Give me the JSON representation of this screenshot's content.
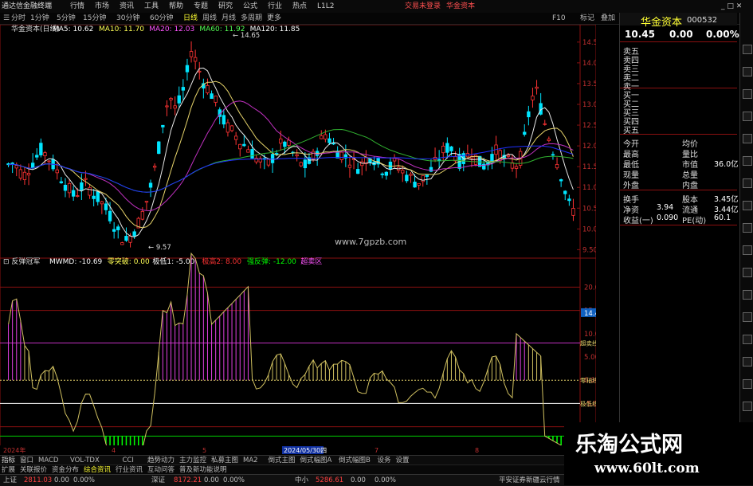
{
  "titlebar": {
    "app": "通达信金融终端",
    "menus": [
      "行情",
      "市场",
      "资讯",
      "工具",
      "帮助",
      "专题",
      "研究",
      "公式",
      "行业",
      "热点",
      "L1L2"
    ],
    "notice": "交易未登录",
    "stock_tab": "华金资本",
    "right": [
      "F10",
      "标记",
      "返回",
      "□",
      "资讯",
      "□",
      "□",
      "选择"
    ]
  },
  "toolbar": {
    "periods": [
      "分时",
      "1分钟",
      "5分钟",
      "15分钟",
      "30分钟",
      "60分钟",
      "日线",
      "周线",
      "月线",
      "多周期",
      "更多"
    ],
    "active": "日线",
    "right": [
      "F10",
      "标记",
      "叠加",
      "返回"
    ]
  },
  "main_chart": {
    "stock": "华金资本(日线)",
    "ma_labels": [
      {
        "text": "MA5: 10.62",
        "color": "#ffffff"
      },
      {
        "text": "MA10: 11.70",
        "color": "#ffff55"
      },
      {
        "text": "MA20: 12.03",
        "color": "#ff55ff"
      },
      {
        "text": "MA60: 11.92",
        "color": "#55ff55"
      },
      {
        "text": "MA120: 11.85",
        "color": "#ffffff"
      }
    ],
    "high_label": "14.65",
    "low_label": "9.57",
    "watermark": "www.7gpzb.com",
    "axis_ticks": [
      "14.50",
      "14.00",
      "13.50",
      "13.00",
      "12.50",
      "12.00",
      "11.50",
      "11.00",
      "10.50",
      "10.00",
      "9.50"
    ],
    "colors": {
      "up": "#ff3333",
      "down": "#00e5ff",
      "ma5": "#e8e8e8",
      "ma10": "#e6d36a",
      "ma20": "#c030c0",
      "ma60": "#30b030",
      "ma120": "#2030ff"
    }
  },
  "indicator": {
    "name": "反弹冠军",
    "labels": [
      {
        "text": "MWMD: -10.69",
        "color": "#ffffff"
      },
      {
        "text": "零突破: 0.00",
        "color": "#ffff55"
      },
      {
        "text": "极低1: -5.00",
        "color": "#ffffff"
      },
      {
        "text": "极高2: 8.00",
        "color": "#ff3333"
      },
      {
        "text": "强反弹: -12.00",
        "color": "#00ff00"
      },
      {
        "text": "超卖区",
        "color": "#ff55ff"
      }
    ],
    "axis_ticks": [
      "20.00",
      "15.00",
      "10.00",
      "5.00",
      "0.00",
      "-5.00",
      "-10.00"
    ],
    "side_labels": [
      "14.43",
      "超卖线",
      "零轴线",
      "极低线",
      "强反弹"
    ],
    "date_labels": [
      "2024年",
      "4",
      "5",
      "2024/05/30四",
      "7",
      "8"
    ]
  },
  "quote": {
    "name": "华金资本",
    "code": "000532",
    "price": "10.45",
    "change": "0.00",
    "pct": "0.00%",
    "order_book": [
      "卖五",
      "卖四",
      "卖三",
      "卖二",
      "卖一",
      "买一",
      "买二",
      "买三",
      "买四",
      "买五"
    ],
    "stats": [
      {
        "l": "今开",
        "r": "均价",
        "rv": ""
      },
      {
        "l": "最高",
        "r": "量比",
        "rv": ""
      },
      {
        "l": "最低",
        "r": "市值",
        "rv": "36.0亿"
      },
      {
        "l": "现量",
        "r": "总量",
        "rv": ""
      },
      {
        "l": "外盘",
        "r": "内盘",
        "rv": ""
      }
    ],
    "fund": [
      {
        "l": "换手",
        "lv": "",
        "r": "股本",
        "rv": "3.45亿"
      },
      {
        "l": "净资",
        "lv": "3.94",
        "r": "流通",
        "rv": "3.44亿"
      },
      {
        "l": "收益(一)",
        "lv": "0.090",
        "r": "PE(动)",
        "rv": "60.1"
      }
    ]
  },
  "tabs1": [
    "指标",
    "窗口",
    "MACD",
    "VOL-TDX",
    "CCI",
    "趋势动力",
    "主力监控",
    "私募主图",
    "MA2",
    "倒式主图",
    "倒式幅图A",
    "倒式幅图B",
    "设务",
    "设置"
  ],
  "tabs2": [
    "扩展",
    "关联报价",
    "资金分布",
    "综合资讯",
    "行业资讯",
    "互动问答",
    "普及新功能说明"
  ],
  "status": [
    {
      "text": "上证",
      "color": "#c0c0c0"
    },
    {
      "text": "2811.03",
      "color": "#ff4040"
    },
    {
      "text": "0.00",
      "color": "#c0c0c0"
    },
    {
      "text": "0.00%",
      "color": "#c0c0c0"
    },
    {
      "text": "深证",
      "color": "#c0c0c0"
    },
    {
      "text": "8172.21",
      "color": "#ff4040"
    },
    {
      "text": "0.00",
      "color": "#c0c0c0"
    },
    {
      "text": "0.00%",
      "color": "#c0c0c0"
    },
    {
      "text": "中小",
      "color": "#c0c0c0"
    },
    {
      "text": "5286.61",
      "color": "#ff4040"
    },
    {
      "text": "0.00",
      "color": "#c0c0c0"
    },
    {
      "text": "0.00%",
      "color": "#c0c0c0"
    },
    {
      "text": "平安证券新疆云行情",
      "color": "#c0c0c0"
    }
  ],
  "watermark2": {
    "line1": "乐淘公式网",
    "line2": "www.60lt.com"
  }
}
